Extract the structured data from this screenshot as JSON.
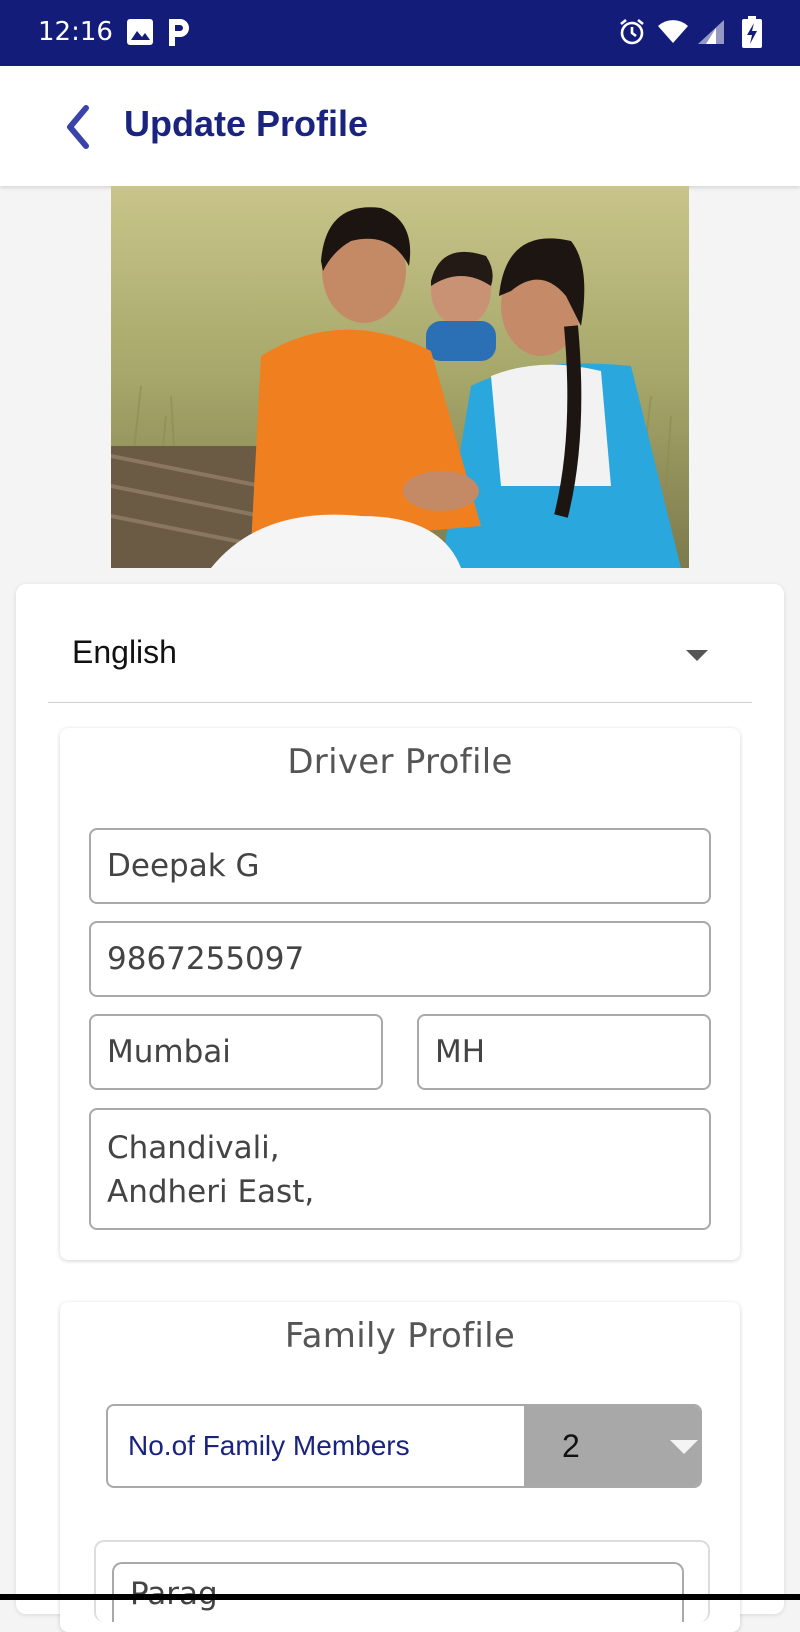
{
  "status_bar": {
    "time": "12:16"
  },
  "app_bar": {
    "title": "Update Profile"
  },
  "language": {
    "selected": "English"
  },
  "driver_profile": {
    "title": "Driver Profile",
    "name": "Deepak G",
    "phone": "9867255097",
    "city": "Mumbai",
    "state": "MH",
    "address_line1": "Chandivali,",
    "address_line2": "Andheri East,"
  },
  "family_profile": {
    "title": "Family Profile",
    "members_label": "No.of Family Members",
    "members_value": "2",
    "member_1_name": "Parag"
  },
  "colors": {
    "primary": "#141c7a",
    "title": "#1a237e"
  }
}
